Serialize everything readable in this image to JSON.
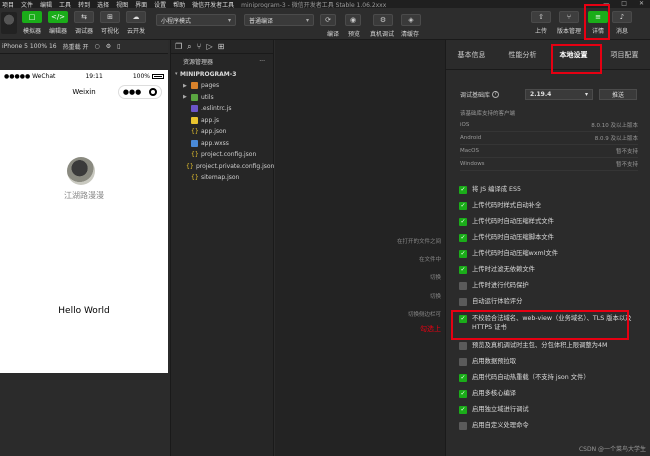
{
  "menubar": {
    "items": [
      "项目",
      "文件",
      "编辑",
      "工具",
      "转到",
      "选择",
      "视图",
      "界面",
      "设置",
      "帮助",
      "微信开发者工具"
    ],
    "title": "miniprogram-3 - 微信开发者工具 Stable 1.06.2xxx"
  },
  "toolbar": {
    "buttons": [
      {
        "label": "模拟器",
        "icon": "□"
      },
      {
        "label": "编辑器",
        "icon": "</>"
      },
      {
        "label": "调试器",
        "icon": "⇆"
      },
      {
        "label": "可视化",
        "icon": "⊞"
      },
      {
        "label": "云开发",
        "icon": "☁"
      }
    ],
    "mode_select": "小程序模式",
    "compile_select": "普通编译",
    "compile_label": "编译",
    "preview_label": "预览",
    "realdebug_label": "真机调试",
    "clearcache_label": "清缓存",
    "right_buttons": [
      {
        "label": "上传",
        "icon": "⇧"
      },
      {
        "label": "版本管理",
        "icon": "⑂"
      },
      {
        "label": "详情",
        "icon": "≡"
      },
      {
        "label": "消息",
        "icon": "🔔"
      }
    ]
  },
  "simbar": {
    "device": "iPhone 5 100% 16",
    "hotreload": "热重载 开"
  },
  "phone": {
    "carrier": "●●●●● WeChat",
    "time": "19:11",
    "battery": "100%",
    "nav_title": "Weixin",
    "capsule_dots": "●●●",
    "nickname": "江湖路漫漫",
    "hello": "Hello World"
  },
  "tree": {
    "header": "资源管理器",
    "more": "···",
    "project": "MINIPROGRAM-3",
    "items": [
      {
        "name": "pages",
        "type": "folder-o",
        "level": 1,
        "caret": "▶"
      },
      {
        "name": "utils",
        "type": "folder-g",
        "level": 1,
        "caret": "▶"
      },
      {
        "name": ".eslintrc.js",
        "type": "rc",
        "level": 1
      },
      {
        "name": "app.js",
        "type": "js",
        "level": 1
      },
      {
        "name": "app.json",
        "type": "json",
        "level": 1
      },
      {
        "name": "app.wxss",
        "type": "wxss",
        "level": 1
      },
      {
        "name": "project.config.json",
        "type": "json",
        "level": 1
      },
      {
        "name": "project.private.config.json",
        "type": "json",
        "level": 1
      },
      {
        "name": "sitemap.json",
        "type": "json",
        "level": 1
      }
    ]
  },
  "editor_hints": [
    "在打开的文件之间",
    "在文件中",
    "切换",
    "切换",
    "切换侧边栏可",
    "勾选上"
  ],
  "panel": {
    "tabs": [
      "基本信息",
      "性能分析",
      "本地设置",
      "项目配置"
    ],
    "active_tab": 2,
    "lib_label": "调试基础库",
    "lib_help": "?",
    "lib_version": "2.19.4",
    "push_label": "推送",
    "support_title": "该基础库支持的客户端",
    "support": [
      {
        "os": "iOS",
        "status": "8.0.10 及以上版本"
      },
      {
        "os": "Android",
        "status": "8.0.9 及以上版本"
      },
      {
        "os": "MacOS",
        "status": "暂不支持"
      },
      {
        "os": "Windows",
        "status": "暂不支持"
      }
    ],
    "options": [
      {
        "text": "将 JS 编译成 ES5",
        "checked": true
      },
      {
        "text": "上传代码时样式自动补全",
        "checked": true
      },
      {
        "text": "上传代码时自动压缩样式文件",
        "checked": true
      },
      {
        "text": "上传代码时自动压缩脚本文件",
        "checked": true
      },
      {
        "text": "上传代码时自动压缩wxml文件",
        "checked": true
      },
      {
        "text": "上传时过滤无依赖文件",
        "checked": true
      },
      {
        "text": "上传时进行代码保护",
        "checked": false
      },
      {
        "text": "自动运行体验评分",
        "checked": false
      },
      {
        "text": "不校验合法域名、web-view（业务域名）、TLS 版本以及 HTTPS 证书",
        "checked": true
      },
      {
        "text": "预览及真机调试时主包、分包体积上限调整为4M",
        "checked": false
      },
      {
        "text": "启用数据预拉取",
        "checked": false
      },
      {
        "text": "启用代码自动热重载（不支持 json 文件）",
        "checked": true
      },
      {
        "text": "启用多核心编译",
        "checked": true
      },
      {
        "text": "启用独立域进行调试",
        "checked": true
      },
      {
        "text": "启用自定义处理命令",
        "checked": false
      }
    ]
  },
  "watermark": "CSDN @一个菜鸟大学生",
  "colors": {
    "accent": "#1aad19",
    "highlight": "#e60012"
  }
}
